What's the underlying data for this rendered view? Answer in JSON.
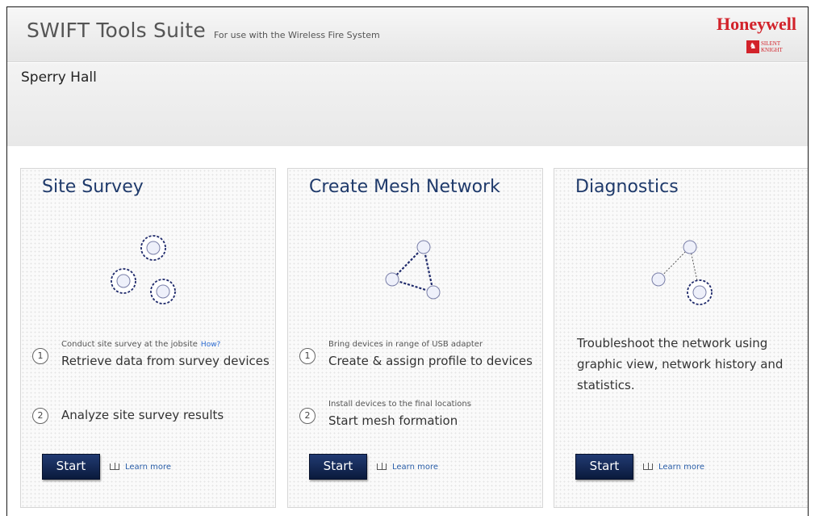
{
  "header": {
    "title": "SWIFT Tools Suite",
    "subtitle": "For use with the Wireless Fire System",
    "logo": {
      "brand": "Honeywell",
      "sub": "SILENT KNIGHT"
    }
  },
  "site": {
    "name": "Sperry Hall"
  },
  "cards": [
    {
      "title": "Site Survey",
      "steps": [
        {
          "num": "1",
          "small": "Conduct site survey at the jobsite",
          "link": "How?",
          "big": "Retrieve data from survey devices"
        },
        {
          "num": "2",
          "small": "",
          "big": "Analyze site survey results"
        }
      ],
      "start": "Start",
      "learn_more": "Learn more"
    },
    {
      "title": "Create Mesh Network",
      "steps": [
        {
          "num": "1",
          "small": "Bring devices in range of USB adapter",
          "big": "Create & assign profile to devices"
        },
        {
          "num": "2",
          "small": "Install devices to the final locations",
          "big": "Start mesh formation"
        }
      ],
      "start": "Start",
      "learn_more": "Learn more"
    },
    {
      "title": "Diagnostics",
      "description": "Troubleshoot the network using graphic view, network history and statistics.",
      "start": "Start",
      "learn_more": "Learn more"
    }
  ],
  "colors": {
    "brand_red": "#d2222a",
    "title_blue": "#1f3a6b",
    "button_navy": "#0f2350"
  }
}
